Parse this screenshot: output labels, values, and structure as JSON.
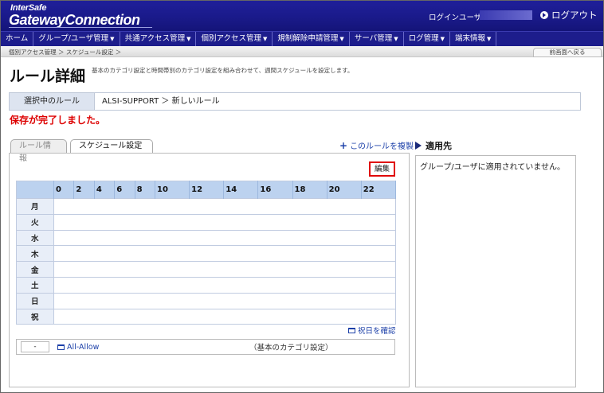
{
  "header": {
    "logo_small": "InterSafe",
    "logo_main": "GatewayConnection",
    "user_label": "ログインユーザ:",
    "logout_label": "ログアウト"
  },
  "nav": [
    {
      "label": "ホーム",
      "dropdown": false
    },
    {
      "label": "グループ/ユーザ管理",
      "dropdown": true
    },
    {
      "label": "共通アクセス管理",
      "dropdown": true
    },
    {
      "label": "個別アクセス管理",
      "dropdown": true
    },
    {
      "label": "規制解除申請管理",
      "dropdown": true
    },
    {
      "label": "サーバ管理",
      "dropdown": true
    },
    {
      "label": "ログ管理",
      "dropdown": true
    },
    {
      "label": "端末情報",
      "dropdown": true
    }
  ],
  "breadcrumb": "個別アクセス管理 ＞ スケジュール設定 ＞",
  "back_label": "前画面へ戻る",
  "page": {
    "title": "ルール詳細",
    "description": "基本のカテゴリ設定と時間帯別のカテゴリ設定を組み合わせて、週間スケジュールを設定します。"
  },
  "selected_rule": {
    "label": "選択中のルール",
    "value": "ALSI-SUPPORT ＞ 新しいルール"
  },
  "save_message": "保存が完了しました。",
  "tabs": [
    {
      "label": "ルール情報",
      "active": false
    },
    {
      "label": "スケジュール設定",
      "active": true
    }
  ],
  "copy_link": "このルールを複製",
  "edit_label": "編集",
  "schedule": {
    "hours": [
      "0",
      "",
      "2",
      "",
      "4",
      "",
      "6",
      "",
      "8",
      "",
      "10",
      "",
      "12",
      "",
      "14",
      "",
      "16",
      "",
      "18",
      "",
      "20",
      "",
      "22",
      ""
    ],
    "days": [
      "月",
      "火",
      "水",
      "木",
      "金",
      "土",
      "日",
      "祝"
    ]
  },
  "holiday_link": "祝日を確認",
  "category": {
    "box": "-",
    "link": "All-Allow",
    "desc": "（基本のカテゴリ設定）"
  },
  "apply": {
    "title": "適用先",
    "message": "グループ/ユーザに適用されていません。"
  },
  "colors": {
    "header_bg": "#1a1a8a",
    "accent_red": "#dd0000",
    "link": "#1b3fa8",
    "grid_header": "#bcd2ef"
  }
}
